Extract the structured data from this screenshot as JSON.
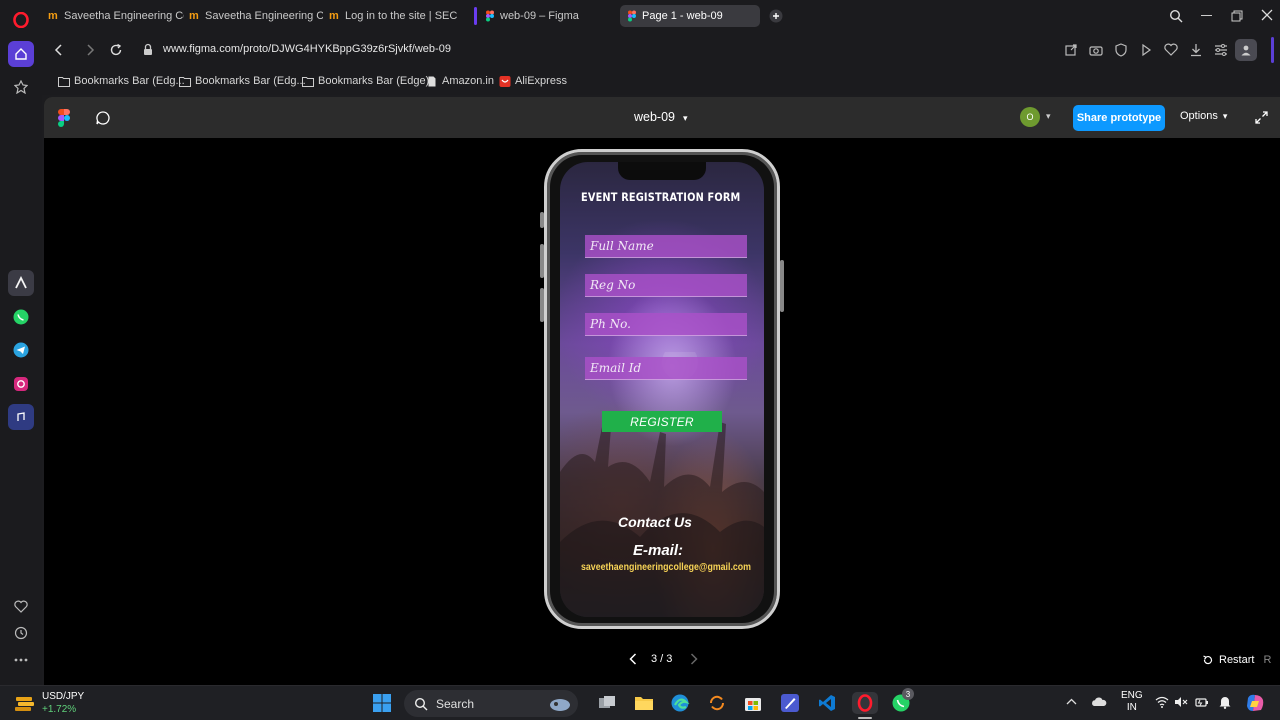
{
  "browser": {
    "tabs": [
      {
        "label": "Saveetha Engineering Coll",
        "icon": "saveetha-favicon"
      },
      {
        "label": "Saveetha Engineering Coll",
        "icon": "saveetha-favicon"
      },
      {
        "label": "Log in to the site | SEC",
        "icon": "saveetha-favicon"
      },
      {
        "label": "web-09 – Figma",
        "icon": "figma-favicon"
      },
      {
        "label": "Page 1 - web-09",
        "icon": "figma-favicon",
        "active": true
      }
    ],
    "url": "www.figma.com/proto/DJWG4HYKBppG39z6rSjvkf/web-09",
    "bookmarks": [
      {
        "label": "Bookmarks Bar (Edg...",
        "icon": "folder-icon"
      },
      {
        "label": "Bookmarks Bar (Edg...",
        "icon": "folder-icon"
      },
      {
        "label": "Bookmarks Bar (Edge)",
        "icon": "folder-icon"
      },
      {
        "label": "Amazon.in",
        "icon": "page-icon"
      },
      {
        "label": "AliExpress",
        "icon": "aliexpress-icon"
      }
    ]
  },
  "figma": {
    "file_title": "web-09",
    "avatar_initial": "O",
    "share_label": "Share prototype",
    "options_label": "Options",
    "pager": "3 / 3",
    "restart_label": "Restart",
    "restart_shortcut": "R"
  },
  "form": {
    "title": "EVENT  REGISTRATION FORM",
    "fields": [
      "Full Name",
      "Reg No",
      "Ph No.",
      "Email Id"
    ],
    "register_label": "REGISTER",
    "contact_heading": "Contact Us",
    "email_label": "E-mail:",
    "email_value": "saveethaengineeringcollege@gmail.com"
  },
  "taskbar": {
    "ticker_symbol": "USD/JPY",
    "ticker_change": "+1.72%",
    "search_placeholder": "Search",
    "lang_line1": "ENG",
    "lang_line2": "IN",
    "whatsapp_badge": "3"
  },
  "colors": {
    "share_button": "#0d99ff",
    "register_button": "#20b04a",
    "field_fill": "#aa50c8",
    "email_text": "#f7d356",
    "opera_red": "#ff1b2d"
  }
}
